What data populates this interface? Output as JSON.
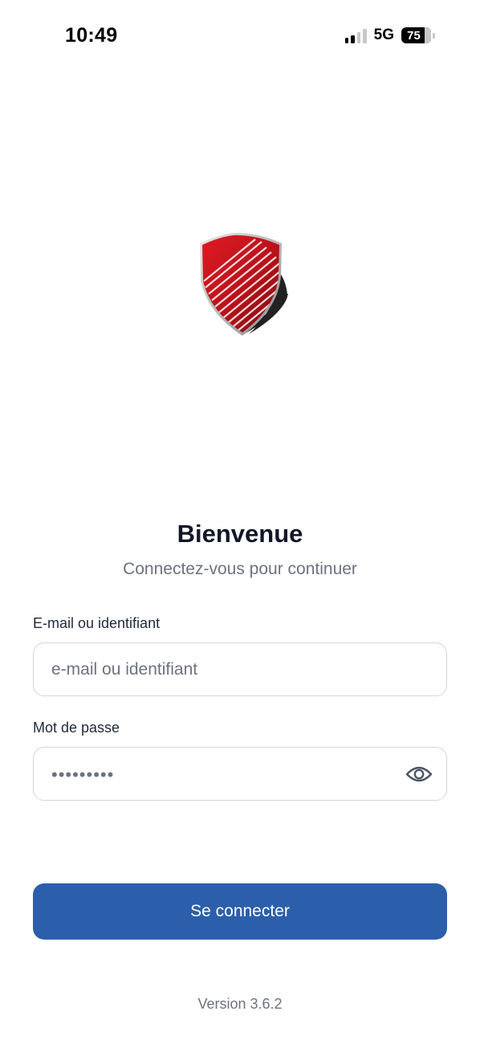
{
  "status_bar": {
    "time": "10:49",
    "network": "5G",
    "battery": "75"
  },
  "logo": {
    "icon": "shield-logo",
    "colors": {
      "primary": "#c8151b",
      "shadow": "#1a1a1a"
    }
  },
  "welcome": {
    "title": "Bienvenue",
    "subtitle": "Connectez-vous pour continuer"
  },
  "form": {
    "login_label": "E-mail ou identifiant",
    "login_placeholder": "e-mail ou identifiant",
    "login_value": "",
    "password_label": "Mot de passe",
    "password_masked": "•••••••••",
    "show_password_icon": "eye-icon",
    "submit_label": "Se connecter"
  },
  "footer": {
    "version": "Version 3.6.2"
  },
  "colors": {
    "accent": "#2c5fab",
    "title": "#101828",
    "muted": "#6b7280",
    "border": "#d1d5db"
  }
}
